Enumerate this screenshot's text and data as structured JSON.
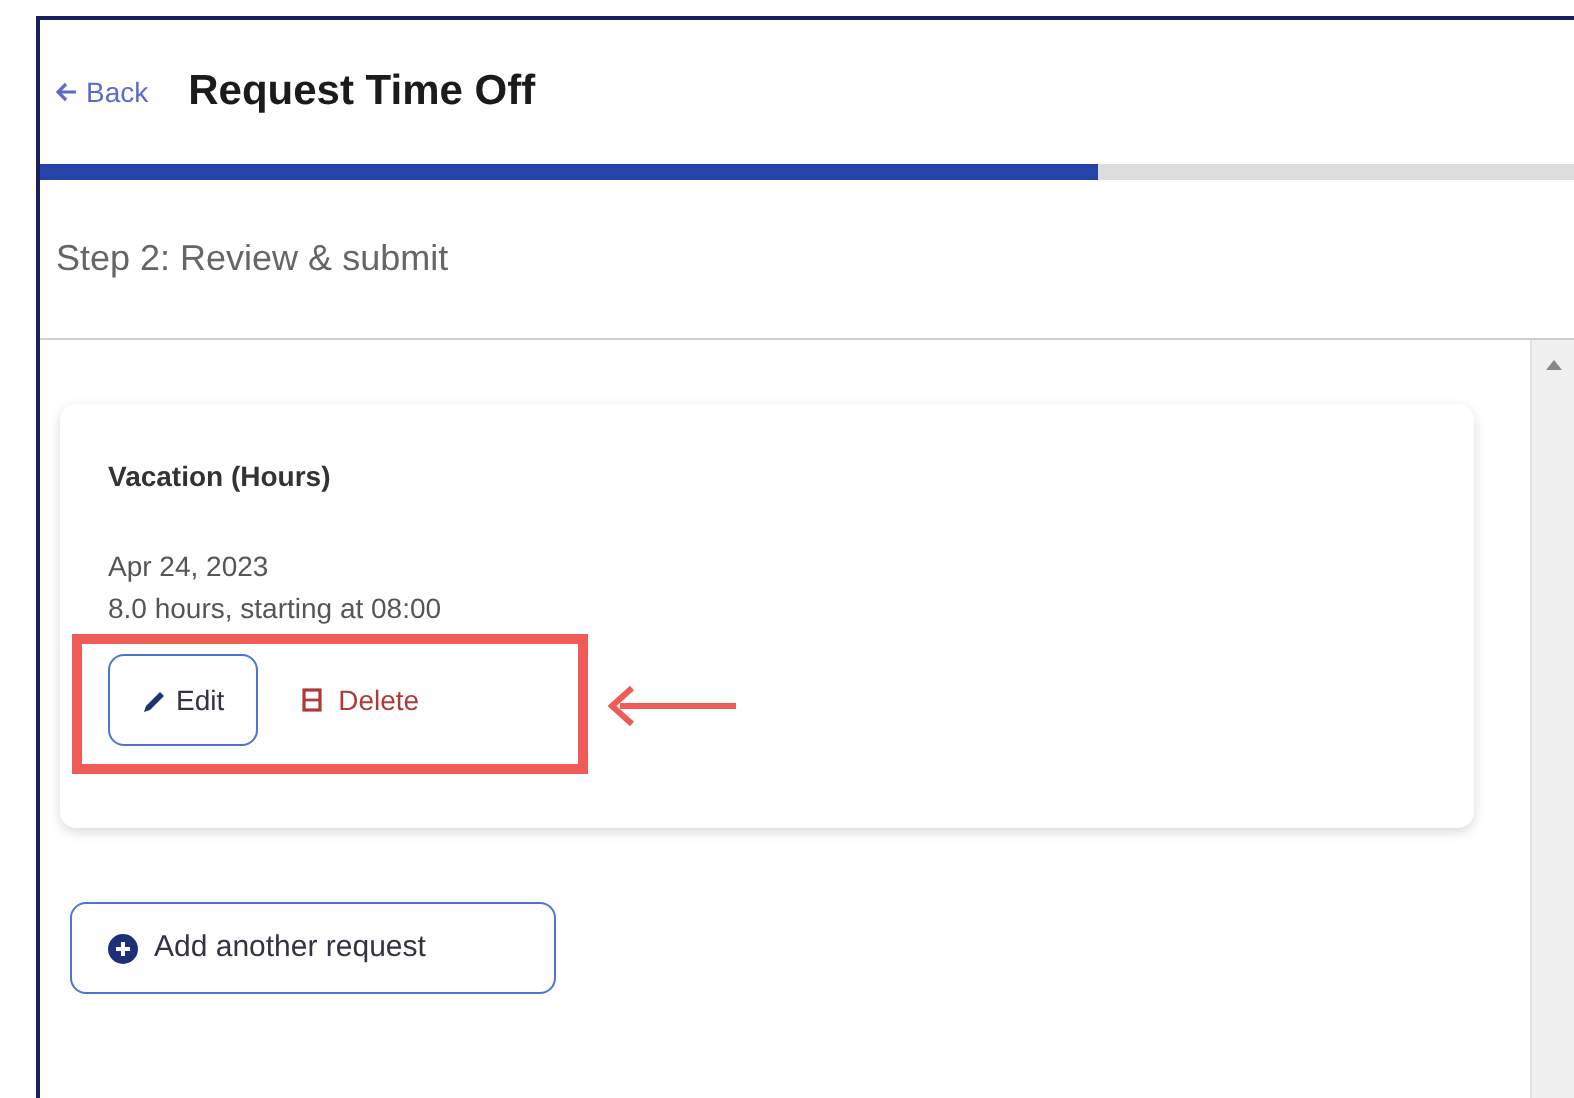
{
  "header": {
    "back_link": "Back",
    "title": "Request Time Off"
  },
  "progress": {
    "level": 0.69
  },
  "step": "Step 2: Review & submit",
  "requests": [
    {
      "type": "Vacation (Hours)",
      "date": "Apr 24, 2023",
      "details": "8.0 hours, starting at 08:00",
      "edit_label": "Edit",
      "delete_label": "Delete",
      "highlighted": true
    }
  ],
  "add_button": "Add another request"
}
